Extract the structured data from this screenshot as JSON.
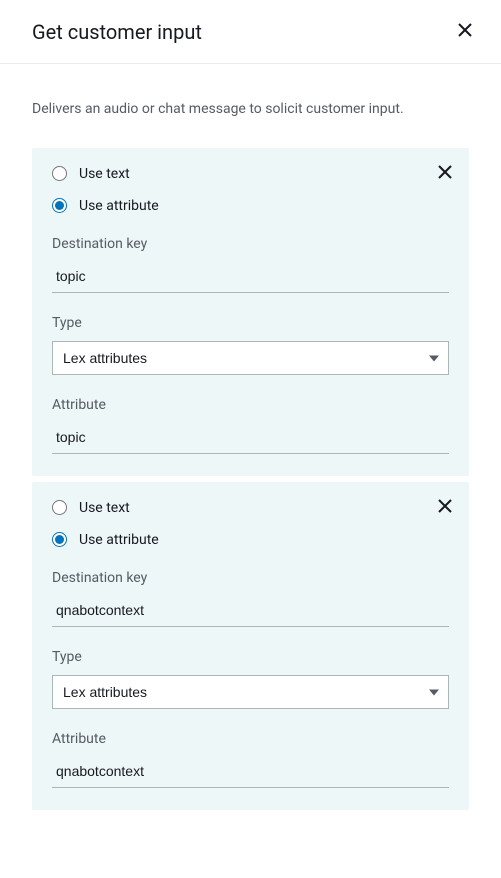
{
  "header": {
    "title": "Get customer input"
  },
  "description": "Delivers an audio or chat message to solicit customer input.",
  "labels": {
    "use_text": "Use text",
    "use_attribute": "Use attribute",
    "destination_key": "Destination key",
    "type": "Type",
    "attribute": "Attribute"
  },
  "cards": [
    {
      "mode": "attribute",
      "destination_key": "topic",
      "type_selected": "Lex attributes",
      "attribute": "topic"
    },
    {
      "mode": "attribute",
      "destination_key": "qnabotcontext",
      "type_selected": "Lex attributes",
      "attribute": "qnabotcontext"
    }
  ]
}
